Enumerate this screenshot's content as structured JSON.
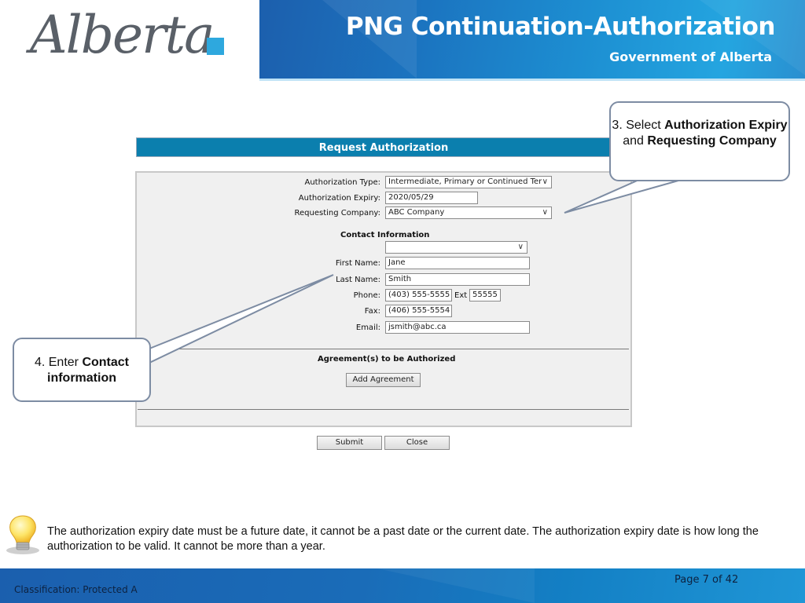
{
  "header": {
    "logo_text": "Alberta",
    "title": "PNG Continuation-Authorization",
    "subtitle": "Government of Alberta",
    "accent_color": "#2ea8de"
  },
  "form": {
    "title": "Request Authorization",
    "fields": {
      "authorization_type": {
        "label": "Authorization Type:",
        "value": "Intermediate, Primary or Continued Ter"
      },
      "authorization_expiry": {
        "label": "Authorization Expiry:",
        "value": "2020/05/29"
      },
      "requesting_company": {
        "label": "Requesting Company:",
        "value": "ABC Company"
      }
    },
    "contact": {
      "heading": "Contact Information",
      "contact_select_value": "",
      "first_name": {
        "label": "First Name:",
        "value": "Jane"
      },
      "last_name": {
        "label": "Last Name:",
        "value": "Smith"
      },
      "phone": {
        "label": "Phone:",
        "value": "(403) 555-5555"
      },
      "ext": {
        "label": "Ext",
        "value": "55555"
      },
      "fax": {
        "label": "Fax:",
        "value": "(406) 555-5554"
      },
      "email": {
        "label": "Email:",
        "value": "jsmith@abc.ca"
      }
    },
    "agreements": {
      "heading": "Agreement(s) to be Authorized",
      "add_button": "Add Agreement"
    },
    "submit_button": "Submit",
    "close_button": "Close",
    "title_bar_color": "#0b7fae"
  },
  "callouts": {
    "step3": {
      "prefix": "3.  Select ",
      "bold1": "Authorization Expiry",
      "mid": " and ",
      "bold2": "Requesting Company"
    },
    "step4": {
      "prefix": "4. Enter ",
      "bold1": "Contact information"
    }
  },
  "note": {
    "icon": "lightbulb-icon",
    "text": "The authorization expiry date must be a future date,  it cannot be a past date or the current date.  The authorization expiry date is how long the authorization to be valid.  It cannot be more than a year."
  },
  "footer": {
    "classification": "Classification: Protected A",
    "page": "Page 7 of 42"
  }
}
